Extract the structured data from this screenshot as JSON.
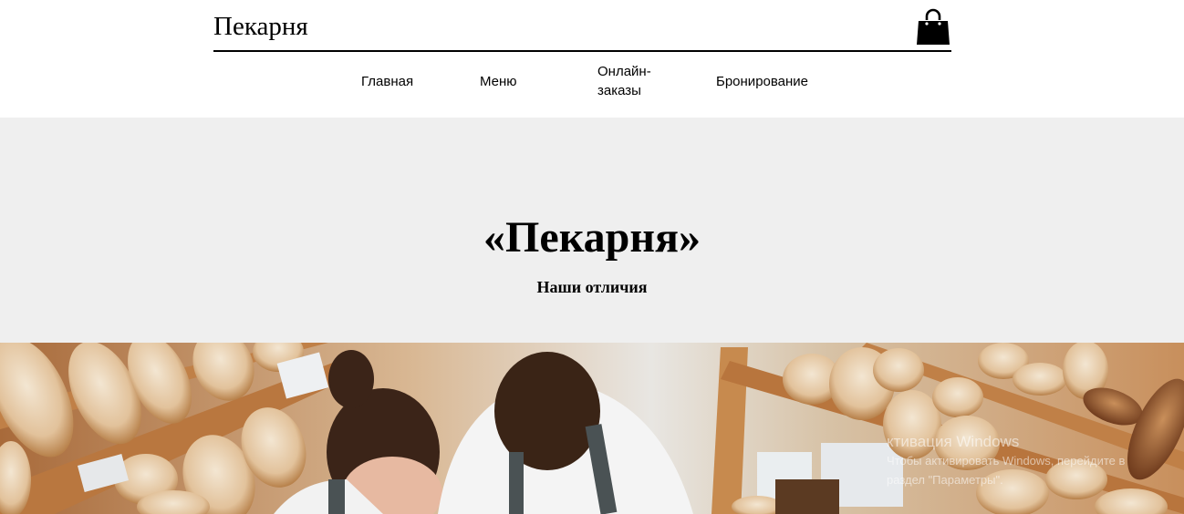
{
  "header": {
    "brand": "Пекарня",
    "cart_icon": "shopping-bag-icon"
  },
  "nav": {
    "items": [
      {
        "label": "Главная"
      },
      {
        "label": "Меню"
      },
      {
        "label": "Онлайн-\nзаказы"
      },
      {
        "label": "Бронирование"
      }
    ]
  },
  "hero": {
    "title": "«Пекарня»",
    "subtitle": "Наши отличия"
  },
  "photo": {
    "description_icon": "bakery-photo"
  },
  "watermark": {
    "line1": "ктивация Windows",
    "line2": "Чтобы активировать Windows, перейдите в",
    "line3": "раздел \"Параметры\"."
  },
  "colors": {
    "hero_bg": "#efefef",
    "text": "#000000",
    "background": "#ffffff"
  }
}
